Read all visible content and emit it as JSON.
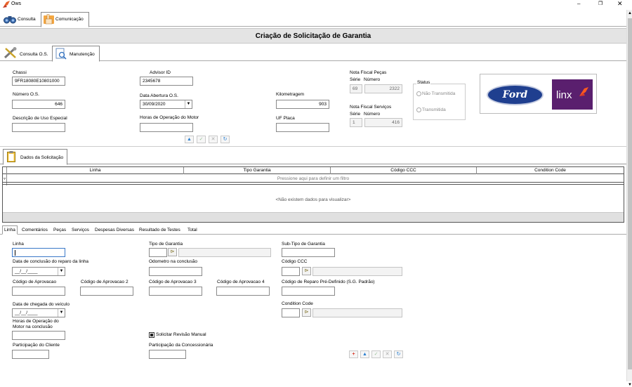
{
  "window": {
    "title": "Ows",
    "minimize": "–",
    "maximize": "❐",
    "close": "✕"
  },
  "top_tabs": {
    "consulta": "Consulta",
    "comunicacao": "Comunicação"
  },
  "page_title": "Criação de Solicitação de Garantia",
  "sub_tabs": {
    "consulta_os": "Consulta O.S.",
    "manutencao": "Manutenção"
  },
  "form": {
    "chassi": {
      "label": "Chassi",
      "value": "9FR18080E10801000"
    },
    "advisor": {
      "label": "Advisor ID",
      "value": "2345678"
    },
    "numero_os": {
      "label": "Número O.S.",
      "value": "646"
    },
    "data_abertura": {
      "label": "Data Abertura O.S.",
      "value": "30/09/2020"
    },
    "kilometragem": {
      "label": "Kilometragem",
      "value": "903"
    },
    "descricao_uso": {
      "label": "Descrição de Uso Especial",
      "value": ""
    },
    "horas_motor": {
      "label": "Horas de Operação do Motor",
      "value": ""
    },
    "uf_placa": {
      "label": "UF Placa",
      "value": ""
    },
    "nf_pecas": {
      "label": "Nota Fiscal Peças",
      "serie_label": "Série",
      "numero_label": "Número",
      "serie": "69",
      "numero": "2322"
    },
    "nf_servicos": {
      "label": "Nota Fiscal Serviços",
      "serie_label": "Série",
      "numero_label": "Número",
      "serie": "1",
      "numero": "416"
    },
    "status": {
      "label": "Status",
      "opt1": "Não Transmitida",
      "opt2": "Transmitida"
    }
  },
  "logos": {
    "ford": "Ford",
    "linx": "linx"
  },
  "dados_tab": "Dados da Solicitação",
  "grid": {
    "columns": [
      "Linha",
      "Tipo Garantia",
      "Código CCC",
      "Condition Code"
    ],
    "filter_text": "Pressione aqui para definir um filtro",
    "empty_text": "<Não existem dados para visualizar>"
  },
  "bottom_tabs": [
    "Linha",
    "Comentários",
    "Peças",
    "Serviços",
    "Despesas Diversas",
    "Resultado de Testes",
    "Total"
  ],
  "linha_form": {
    "linha": "Linha",
    "tipo_garantia": "Tipo de Garantia",
    "sub_tipo": "Sub-Tipo de Garantia",
    "data_conclusao": "Data de conclusão do reparo da linha",
    "date_placeholder": "__/__/____",
    "odometro": "Odometro na conclusão",
    "codigo_ccc": "Código CCC",
    "cod_aprov": "Código de Aprovacao",
    "cod_aprov2": "Código de Aprovacao 2",
    "cod_aprov3": "Código de Aprovacao 3",
    "cod_aprov4": "Código de Aprovacao 4",
    "cod_reparo": "Código de Reparo Pré-Definido (S.G. Padrão)",
    "data_chegada": "Data de chegada do veículo",
    "condition_code": "Condition Code",
    "horas_conclusao_1": "Horas de Operação do",
    "horas_conclusao_2": "Motor na conclusão",
    "solicitar_revisao": "Solicitar Revisão Manual",
    "part_cliente": "Participação do Cliente",
    "part_concessionaria": "Participação da Concessionária"
  },
  "colors": {
    "accent_red": "#d83a2a",
    "ford_blue": "#1f3f8f",
    "linx_purple": "#5a1f6e",
    "header_bg": "#e4e4e4"
  }
}
